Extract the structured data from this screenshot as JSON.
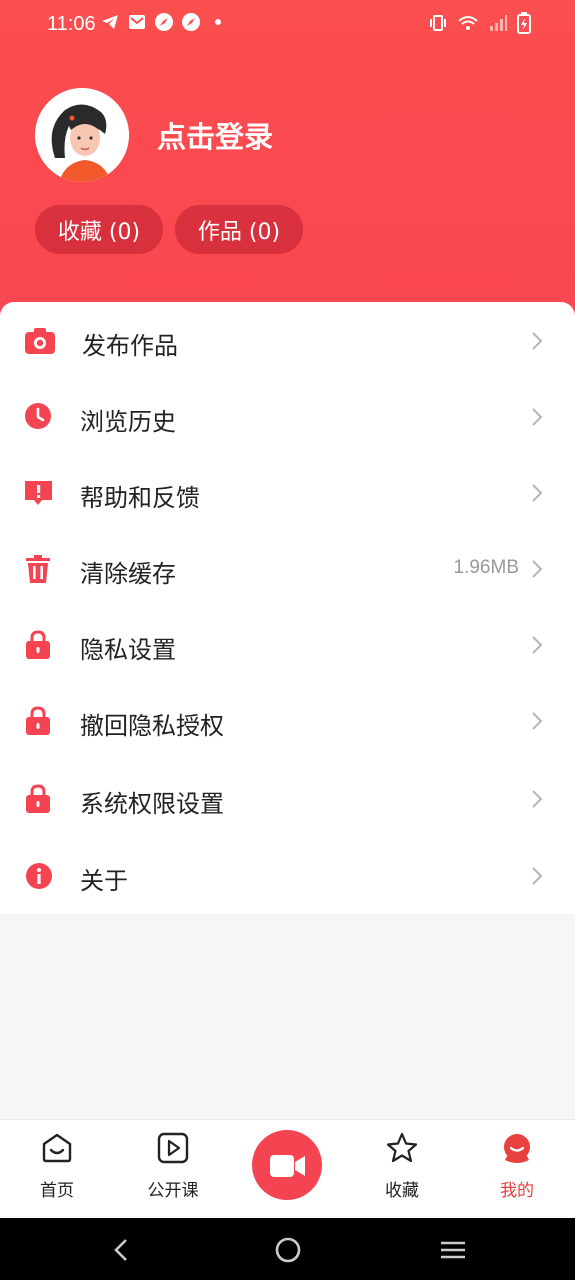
{
  "status_bar": {
    "time": "11:06",
    "left_icons": [
      "telegram-icon",
      "mail-icon",
      "compass-icon",
      "compass-icon",
      "dot-icon"
    ],
    "right_icons": [
      "vibrate-icon",
      "wifi-icon",
      "signal-icon",
      "battery-icon"
    ]
  },
  "profile": {
    "login_text": "点击登录",
    "favorites_label": "收藏 (0)",
    "works_label": "作品 (0)"
  },
  "menu": {
    "items": [
      {
        "label": "发布作品",
        "icon": "camera-icon",
        "value": ""
      },
      {
        "label": "浏览历史",
        "icon": "clock-icon",
        "value": ""
      },
      {
        "label": "帮助和反馈",
        "icon": "feedback-icon",
        "value": ""
      },
      {
        "label": "清除缓存",
        "icon": "trash-icon",
        "value": "1.96MB"
      },
      {
        "label": "隐私设置",
        "icon": "lock-icon",
        "value": ""
      },
      {
        "label": "撤回隐私授权",
        "icon": "lock-icon",
        "value": ""
      },
      {
        "label": "系统权限设置",
        "icon": "lock-icon",
        "value": ""
      },
      {
        "label": "关于",
        "icon": "info-icon",
        "value": ""
      }
    ]
  },
  "bottom_nav": {
    "items": [
      {
        "label": "首页",
        "icon": "home-icon",
        "active": false
      },
      {
        "label": "公开课",
        "icon": "play-icon",
        "active": false
      },
      {
        "label": "",
        "icon": "video-camera-icon",
        "active": false
      },
      {
        "label": "收藏",
        "icon": "star-icon",
        "active": false
      },
      {
        "label": "我的",
        "icon": "profile-face-icon",
        "active": true
      }
    ]
  },
  "colors": {
    "accent": "#f54451",
    "header": "#fb4e4e",
    "active_nav": "#e8403f"
  }
}
